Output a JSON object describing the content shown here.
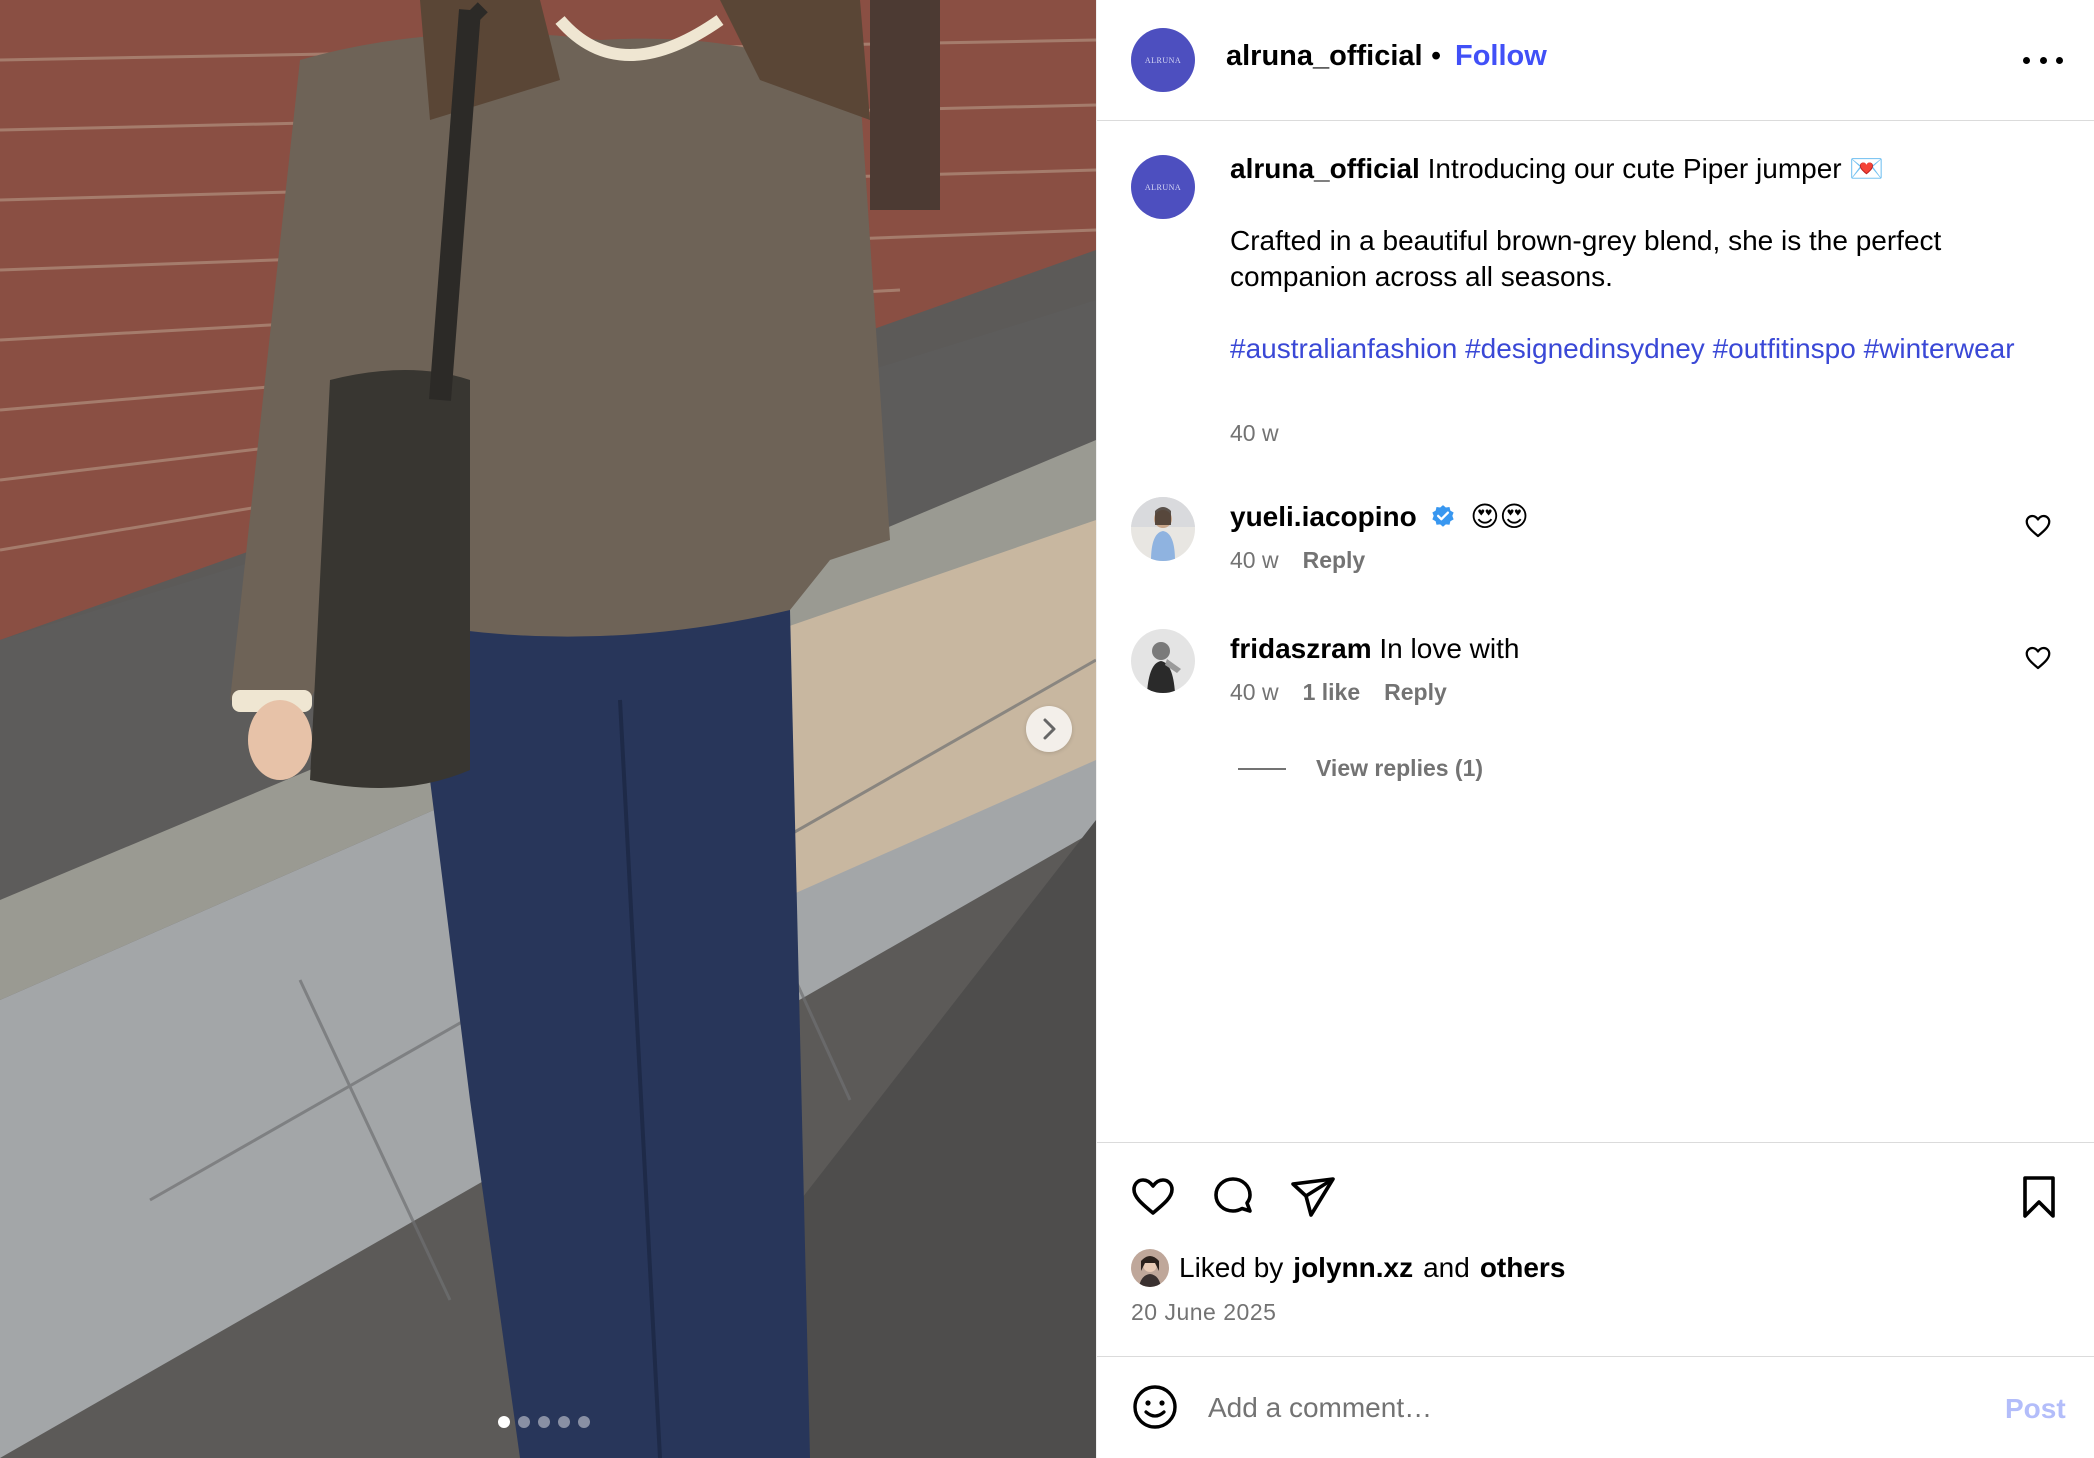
{
  "post": {
    "username": "alruna_official",
    "separator": "•",
    "follow_label": "Follow",
    "more_icon": "more-horizontal-icon",
    "brand_avatar_text": "ALRUNA",
    "caption": {
      "username": "alruna_official",
      "line1": "Introducing our cute Piper jumper 💌",
      "line2": "Crafted in a beautiful brown-grey blend, she is the perfect companion across all seasons.",
      "hashtags": [
        "#australianfashion",
        "#designedinsydney",
        "#outfitinspo",
        "#winterwear"
      ],
      "time": "40 w"
    },
    "comments": [
      {
        "username": "yueli.iacopino",
        "verified": true,
        "text": "😍😍",
        "time": "40 w",
        "likes": "",
        "reply_label": "Reply"
      },
      {
        "username": "fridaszram",
        "verified": false,
        "text": "In love with",
        "time": "40 w",
        "likes": "1 like",
        "reply_label": "Reply",
        "view_replies": "View replies (1)"
      }
    ],
    "liked_by": {
      "prefix": "Liked by",
      "user": "jolynn.xz",
      "middle": "and",
      "others": "others"
    },
    "date": "20 June 2025",
    "add_comment_placeholder": "Add a comment…",
    "post_label": "Post"
  },
  "carousel": {
    "slide_count": 5,
    "active_index": 0
  },
  "colors": {
    "link_blue": "#4150f7",
    "hashtag_blue": "#3a48d6",
    "muted": "#737373",
    "brand_avatar": "#4d4fbf",
    "post_disabled": "#b3bdfa"
  }
}
